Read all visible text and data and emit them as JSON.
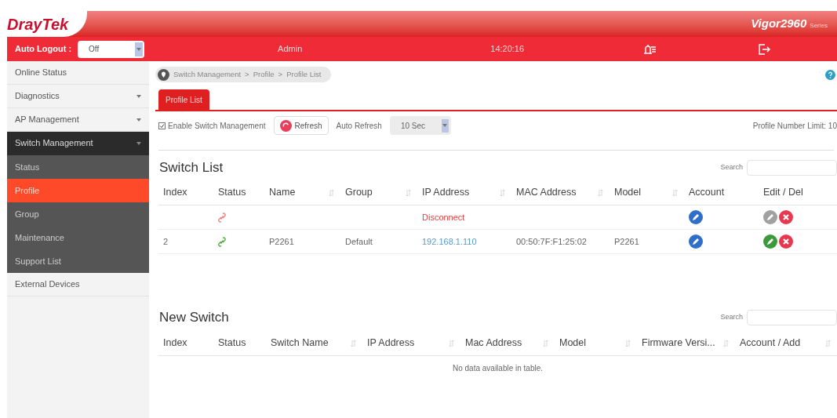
{
  "header": {
    "brand": "DrayTek",
    "model": "Vigor2960",
    "model_suffix": "Series",
    "auto_logout_label": "Auto Logout :",
    "auto_logout_value": "Off",
    "user": "Admin",
    "time": "14:20:16"
  },
  "sidebar": {
    "items": [
      {
        "label": "Online Status",
        "expandable": false,
        "expanded": false
      },
      {
        "label": "Diagnostics",
        "expandable": true,
        "expanded": false
      },
      {
        "label": "AP Management",
        "expandable": true,
        "expanded": false
      },
      {
        "label": "Switch Management",
        "expandable": true,
        "expanded": true,
        "children": [
          {
            "label": "Status",
            "selected": false
          },
          {
            "label": "Profile",
            "selected": true
          },
          {
            "label": "Group",
            "selected": false
          },
          {
            "label": "Maintenance",
            "selected": false
          },
          {
            "label": "Support List",
            "selected": false
          }
        ]
      },
      {
        "label": "External Devices",
        "expandable": false,
        "expanded": false
      }
    ]
  },
  "breadcrumb": [
    "Switch Management",
    ">",
    "Profile",
    ">",
    "Profile List"
  ],
  "tabs": [
    {
      "label": "Profile List",
      "selected": true
    }
  ],
  "toolbar": {
    "enable_label": "Enable Switch Management",
    "enable_checked": true,
    "refresh": "Refresh",
    "auto_refresh_label": "Auto Refresh",
    "auto_refresh_value": "10 Sec",
    "limit": "Profile Number Limit: 10"
  },
  "switch_list": {
    "title": "Switch List",
    "search_label": "Search",
    "columns": [
      {
        "label": "Index",
        "sortable": false
      },
      {
        "label": "Status",
        "sortable": false
      },
      {
        "label": "Name",
        "sortable": true
      },
      {
        "label": "Group",
        "sortable": true
      },
      {
        "label": "IP Address",
        "sortable": true
      },
      {
        "label": "MAC Address",
        "sortable": true
      },
      {
        "label": "Model",
        "sortable": true
      },
      {
        "label": "Account",
        "sortable": false
      },
      {
        "label": "Edit / Del",
        "sortable": false
      }
    ],
    "rows": [
      {
        "connected": false,
        "ip": "Disconnect",
        "editable": false
      },
      {
        "connected": true,
        "index": "2",
        "name": "P2261",
        "group": "Default",
        "ip": "192.168.1.110",
        "mac": "00:50:7F:F1:25:02",
        "model": "P2261",
        "editable": true
      }
    ]
  },
  "new_switch": {
    "title": "New Switch",
    "search_label": "Search",
    "columns": [
      {
        "label": "Index",
        "sortable": false
      },
      {
        "label": "Status",
        "sortable": false
      },
      {
        "label": "Switch Name",
        "sortable": true
      },
      {
        "label": "IP Address",
        "sortable": true
      },
      {
        "label": "Mac Address",
        "sortable": true
      },
      {
        "label": "Model",
        "sortable": true
      },
      {
        "label": "Firmware Versi...",
        "sortable": true
      },
      {
        "label": "Account / Add",
        "sortable": true
      }
    ],
    "empty": "No data available in table."
  }
}
